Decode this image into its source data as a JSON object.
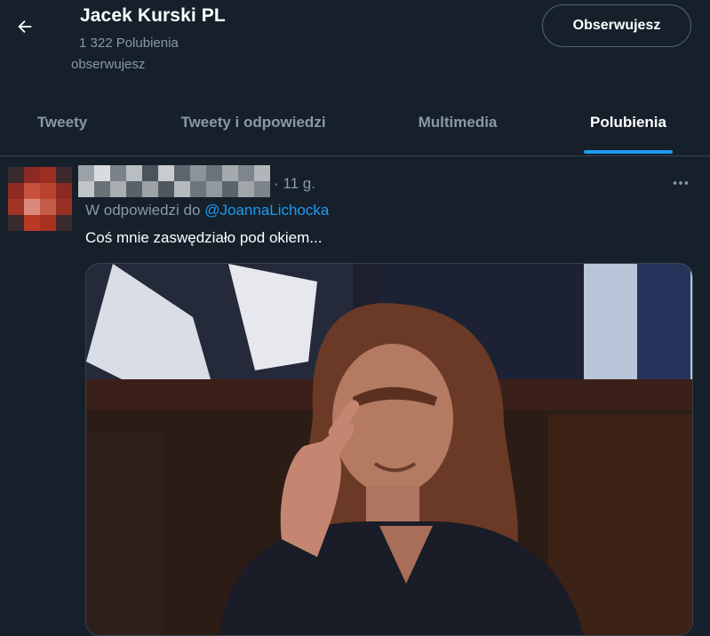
{
  "header": {
    "back_icon": "arrow-left-icon",
    "title": "Jacek Kurski PL",
    "subtitle": "1 322 Polubienia",
    "status": "obserwujesz",
    "follow_label": "Obserwujesz"
  },
  "tabs": [
    {
      "label": "Tweety"
    },
    {
      "label": "Tweety i odpowiedzi"
    },
    {
      "label": "Multimedia"
    },
    {
      "label": "Polubienia",
      "active": true
    }
  ],
  "colors": {
    "background": "#15202b",
    "accent": "#1d9bf0",
    "muted_text": "#8b98a5",
    "divider": "#38444d"
  },
  "tweet": {
    "time": "· 11 g.",
    "more_icon": "more-horizontal-icon",
    "reply_prefix": "W odpowiedzi do",
    "reply_handle": "@JoannaLichocka",
    "text": "Coś mnie zaswędziało pod okiem...",
    "media_type": "video-frame"
  }
}
